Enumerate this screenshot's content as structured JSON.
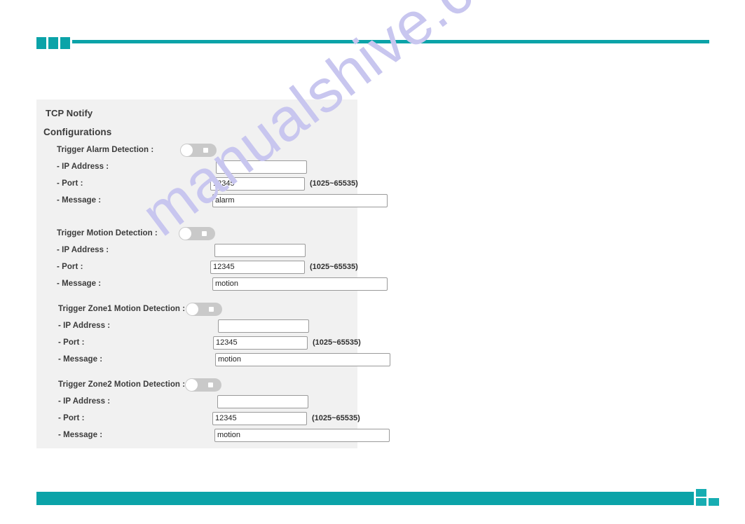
{
  "decoration": {
    "accent_color": "#0ba3a8",
    "accent_color_light": "#17adb2"
  },
  "watermark": {
    "text": "manualshive.com",
    "color": "#c8c6ef"
  },
  "panel": {
    "title": "TCP Notify",
    "subtitle": "Configurations",
    "background": "#f1f1f1"
  },
  "field_labels": {
    "ip_address": "- IP Address :",
    "port": "- Port :",
    "message": "- Message :",
    "port_hint": "(1025~65535)"
  },
  "groups": [
    {
      "trigger_label": "Trigger Alarm Detection :",
      "toggle_state": "off",
      "ip_address": "",
      "ip_placeholder": "",
      "port": "12345",
      "port_hint": "(1025~65535)",
      "message": "alarm"
    },
    {
      "trigger_label": "Trigger Motion Detection :",
      "toggle_state": "off",
      "ip_address": "",
      "ip_placeholder": "",
      "port": "12345",
      "port_hint": "(1025~65535)",
      "message": "motion"
    },
    {
      "trigger_label": "Trigger Zone1 Motion Detection :",
      "toggle_state": "off",
      "ip_address": "",
      "ip_placeholder": "",
      "port": "12345",
      "port_hint": "(1025~65535)",
      "message": "motion"
    },
    {
      "trigger_label": "Trigger Zone2 Motion Detection :",
      "toggle_state": "off",
      "ip_address": "",
      "ip_placeholder": "",
      "port": "12345",
      "port_hint": "(1025~65535)",
      "message": "motion"
    }
  ]
}
